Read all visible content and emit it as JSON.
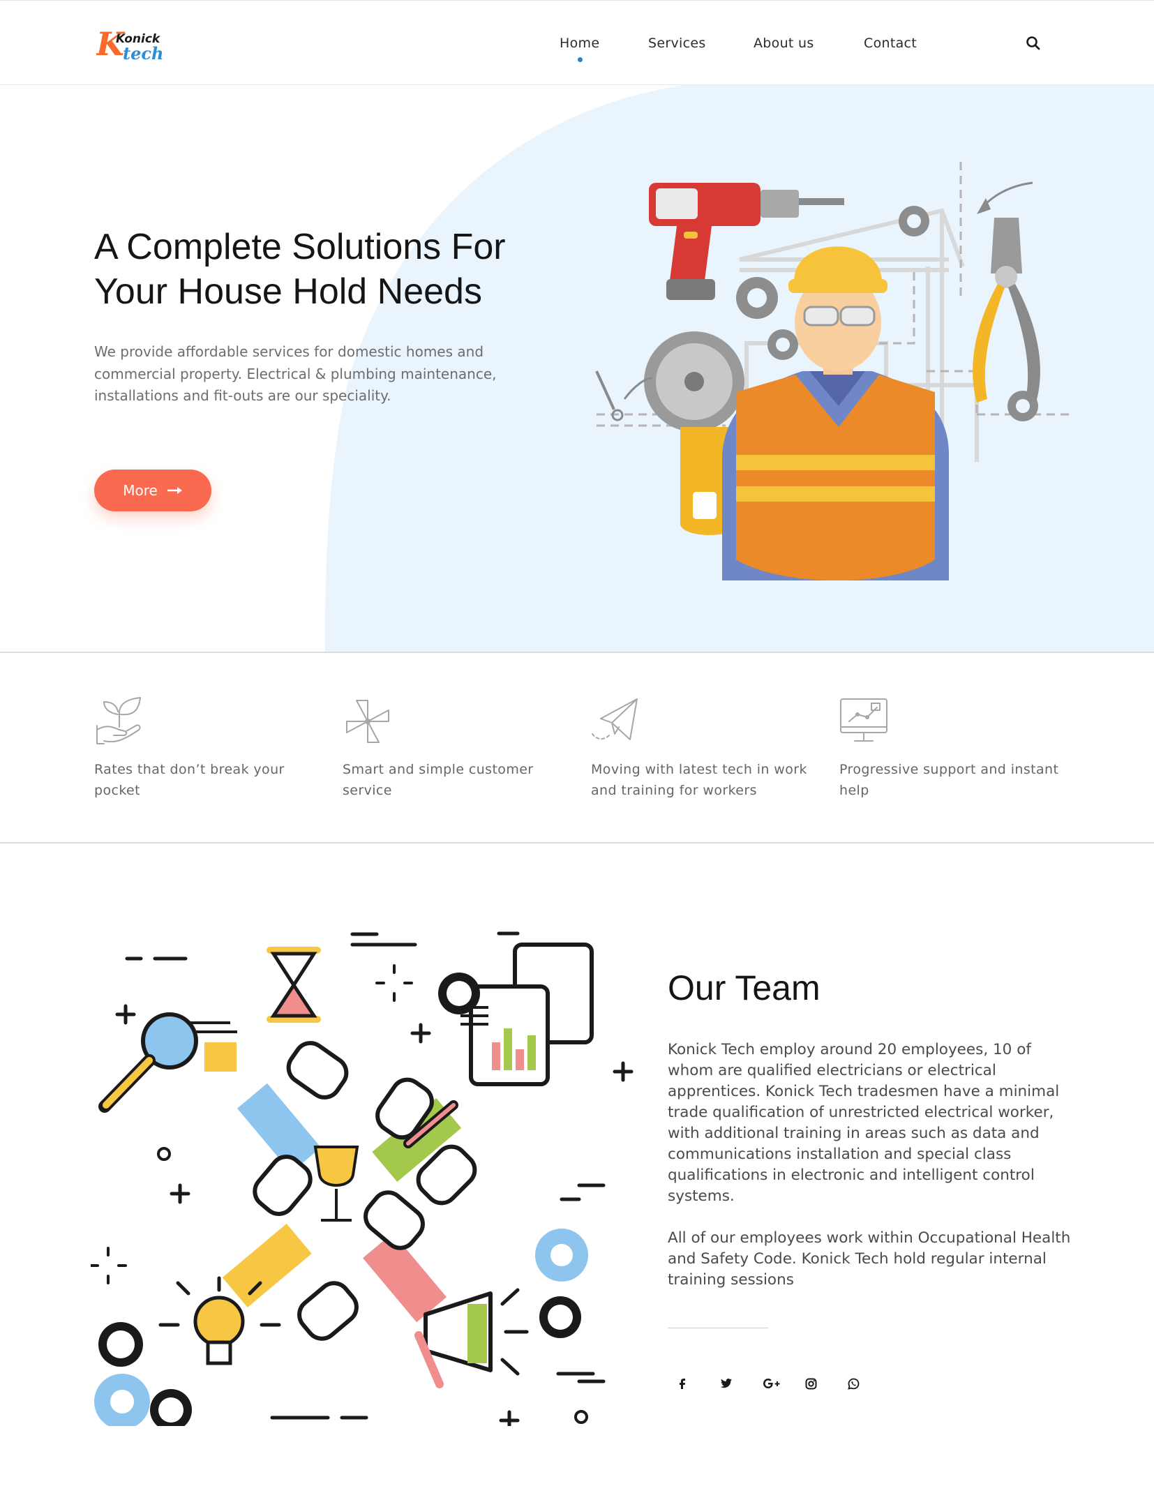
{
  "header": {
    "logo": {
      "line1": "Konick",
      "line2": "tech"
    },
    "nav": [
      {
        "label": "Home",
        "active": true
      },
      {
        "label": "Services",
        "active": false
      },
      {
        "label": "About us",
        "active": false
      },
      {
        "label": "Contact",
        "active": false
      }
    ],
    "search_icon": "search-icon"
  },
  "hero": {
    "title_line1": "A Complete Solutions For",
    "title_line2": "Your House Hold Needs",
    "description": "We provide affordable services for domestic homes and commercial property. Electrical & plumbing maintenance, installations and fit-outs are our speciality.",
    "button_label": "More",
    "button_icon": "arrow-right-icon",
    "accent": "#f96a50",
    "blob_color": "#eaf4fd"
  },
  "features": [
    {
      "icon": "plant-hand-icon",
      "text": "Rates that don’t break your pocket"
    },
    {
      "icon": "pinwheel-icon",
      "text": "Smart and simple customer service"
    },
    {
      "icon": "paper-plane-icon",
      "text": "Moving with latest tech in work and training for workers"
    },
    {
      "icon": "monitor-chart-icon",
      "text": "Progressive support and instant help"
    }
  ],
  "team": {
    "title": "Our Team",
    "paragraph1": "Konick Tech employ around 20 employees, 10 of whom are qualified electricians or electrical apprentices. Konick Tech tradesmen have a minimal trade qualification of unrestricted electrical worker, with additional training in areas such as data and communications installation and special class qualifications in electronic and intelligent control systems.",
    "paragraph2": "All of our employees work within Occupational Health and Safety Code. Konick Tech hold regular internal training sessions",
    "socials": [
      "facebook-icon",
      "twitter-icon",
      "google-plus-icon",
      "instagram-icon",
      "whatsapp-icon"
    ]
  }
}
